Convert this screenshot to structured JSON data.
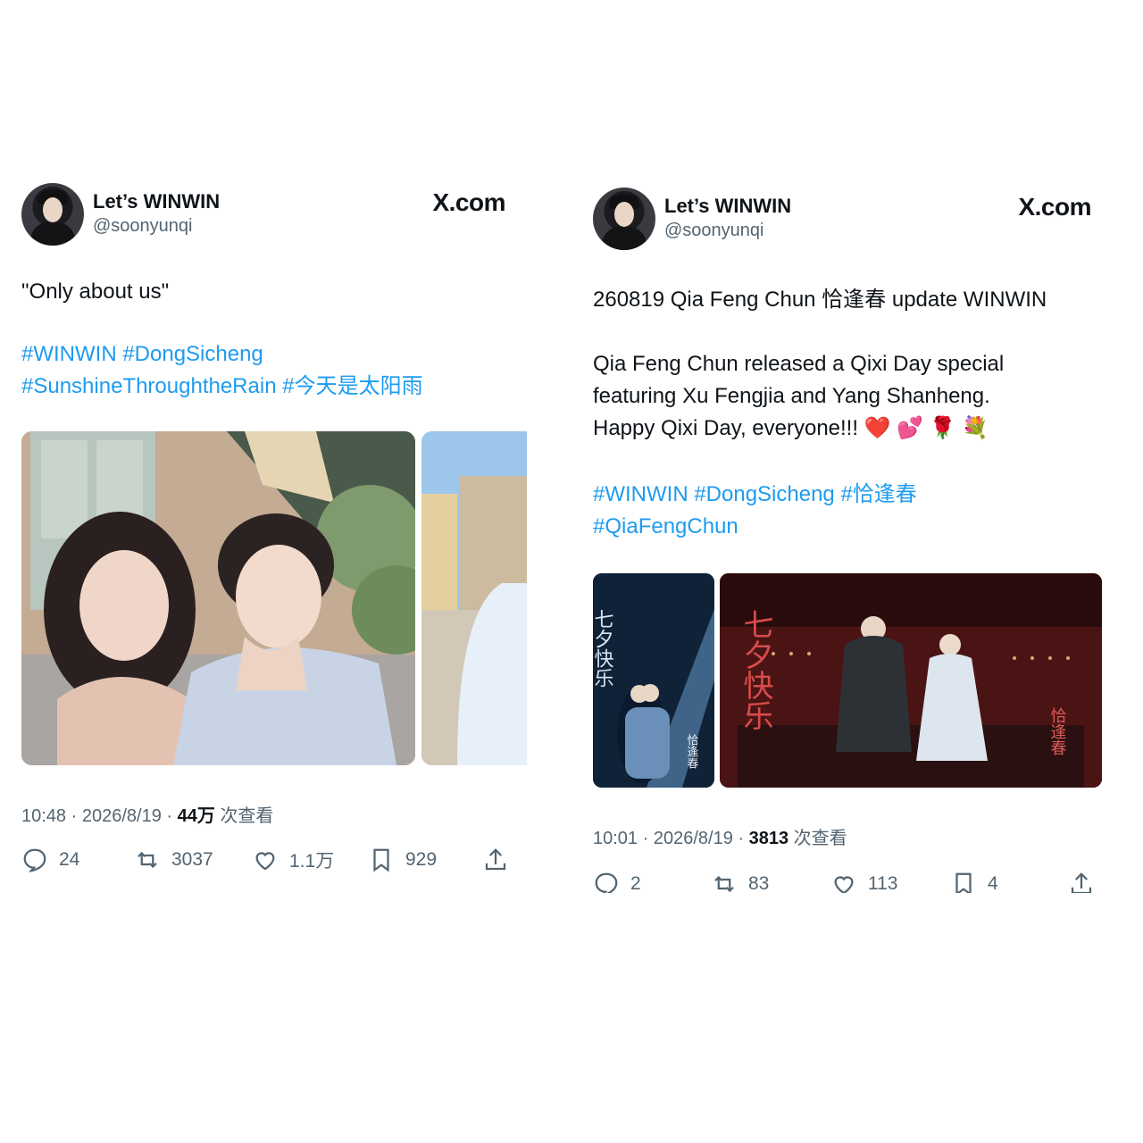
{
  "tweets": [
    {
      "author": {
        "name": "Let’s WINWIN",
        "handle": "@soonyunqi"
      },
      "brand": "X.com",
      "text": "\"Only about us\"",
      "hashtags_line1": [
        "#WINWIN",
        "#DongSicheng"
      ],
      "hashtags_line2": [
        "#SunshineThroughtheRain",
        "#今天是太阳雨"
      ],
      "timestamp": {
        "time": "10:48",
        "date": "2026/8/19",
        "views": "44万",
        "views_label": "次查看"
      },
      "actions": {
        "replies": "24",
        "retweets": "3037",
        "likes": "1.1万",
        "bookmarks": "929"
      },
      "icons": [
        "reply-icon",
        "retweet-icon",
        "like-icon",
        "bookmark-icon",
        "share-icon"
      ]
    },
    {
      "author": {
        "name": "Let’s WINWIN",
        "handle": "@soonyunqi"
      },
      "brand": "X.com",
      "text_line1": "260819 Qia Feng Chun 恰逢春 update WINWIN",
      "text_para2": [
        "Qia Feng Chun released a Qixi Day special",
        "featuring Xu Fengjia and Yang Shanheng.",
        "Happy Qixi Day, everyone!!! ❤️ 💕 🌹 💐"
      ],
      "hashtags_line1": [
        "#WINWIN",
        "#DongSicheng",
        "#恰逢春"
      ],
      "hashtags_line2": [
        "#QiaFengChun"
      ],
      "timestamp": {
        "time": "10:01",
        "date": "2026/8/19",
        "views": "3813",
        "views_label": "次查看"
      },
      "actions": {
        "replies": "2",
        "retweets": "83",
        "likes": "113",
        "bookmarks": "4"
      },
      "posters": {
        "small_title": "七夕快乐",
        "small_sub": "恰逢春",
        "large_title": "七夕快乐",
        "large_sub": "恰逢春"
      }
    }
  ],
  "colors": {
    "link": "#1d9bf0",
    "secondary_text": "#536471",
    "text": "#0f1419"
  }
}
